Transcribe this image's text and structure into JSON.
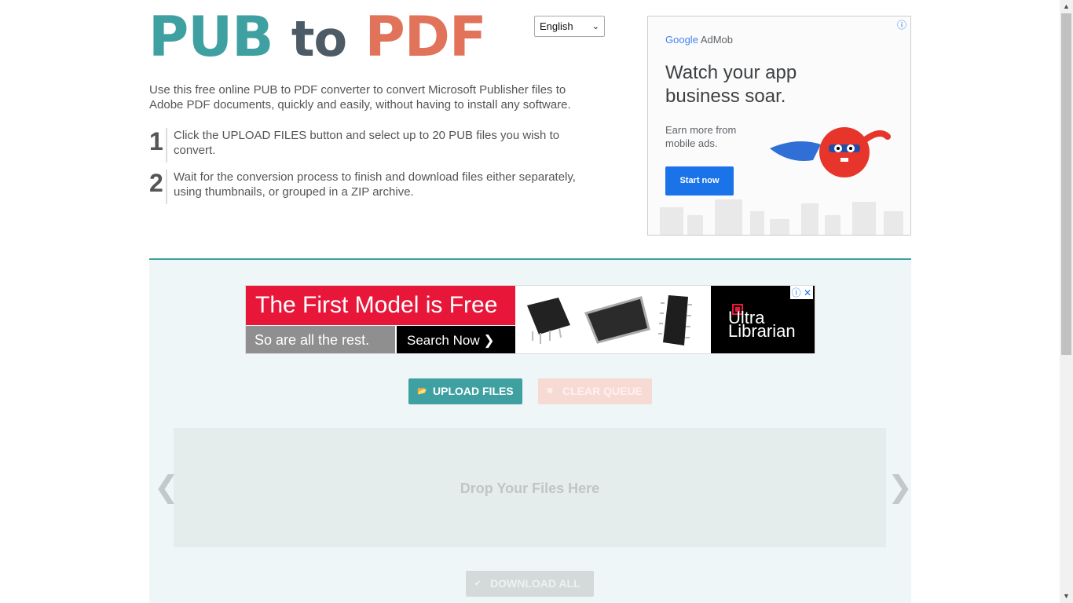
{
  "logo": {
    "part1": "PUB",
    "part2": "to",
    "part3": "PDF"
  },
  "language": {
    "selected": "English"
  },
  "intro": "Use this free online PUB to PDF converter to convert Microsoft Publisher files to Adobe PDF documents, quickly and easily, without having to install any software.",
  "steps": [
    {
      "num": "1",
      "text": "Click the UPLOAD FILES button and select up to 20 PUB files you wish to convert."
    },
    {
      "num": "2",
      "text": "Wait for the conversion process to finish and download files either separately, using thumbnails, or grouped in a ZIP archive."
    }
  ],
  "ad_right": {
    "brand_google": "Google",
    "brand_product": "AdMob",
    "headline": "Watch your app business soar.",
    "sub": "Earn more from mobile ads.",
    "cta": "Start now"
  },
  "banner": {
    "headline": "The First Model is Free",
    "sub": "So are all the rest.",
    "cta": "Search Now ❯",
    "logo_line1": "Ultra",
    "logo_line2": "Librarian"
  },
  "buttons": {
    "upload": "UPLOAD FILES",
    "clear": "CLEAR QUEUE",
    "download": "DOWNLOAD ALL"
  },
  "dropzone": {
    "label": "Drop Your Files Here"
  },
  "colors": {
    "teal": "#3fa0a1",
    "slate": "#4d5b66",
    "coral": "#e2735b",
    "panel_bg": "#eef6f7"
  }
}
